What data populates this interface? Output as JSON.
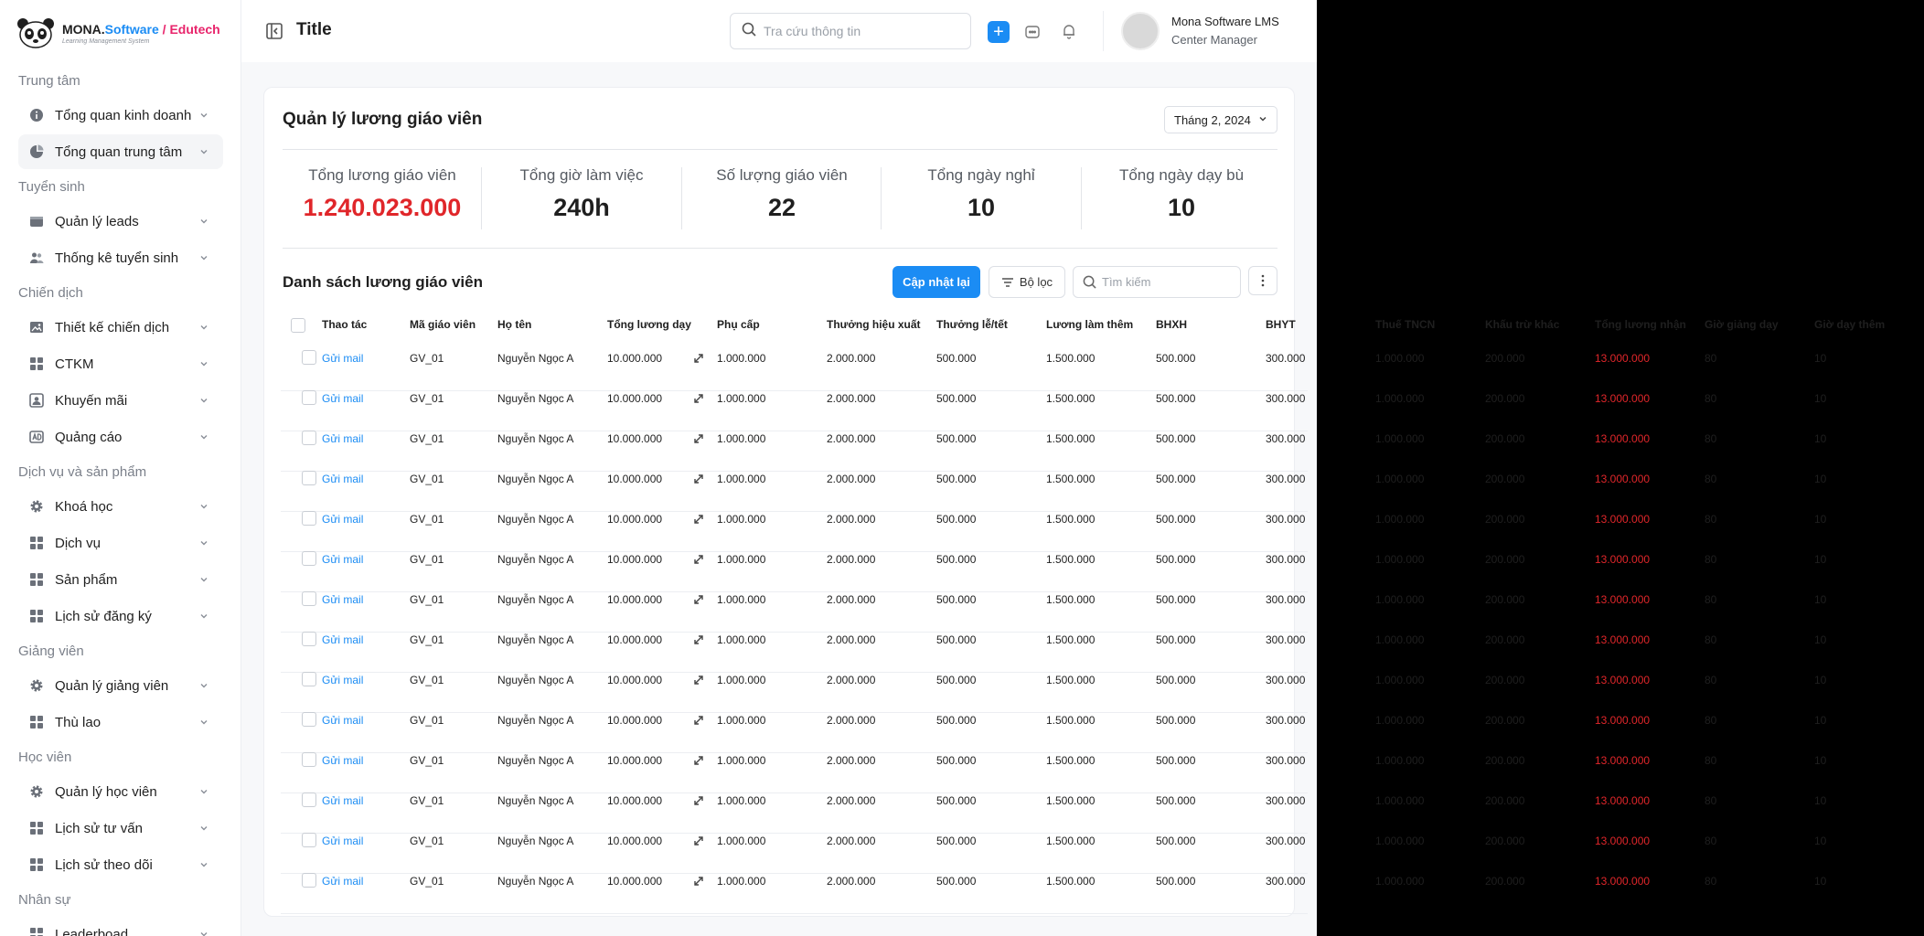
{
  "brand": {
    "name_part1": "MONA",
    "name_part2": "Software",
    "slash": " / ",
    "name_part3": "Edutech",
    "tagline": "Learning Management System"
  },
  "sidebar": {
    "groups": [
      {
        "label": "Trung tâm",
        "items": [
          {
            "label": "Tổng quan kinh doanh",
            "icon": "info-icon"
          },
          {
            "label": "Tổng quan trung tâm",
            "icon": "pie-chart-icon",
            "active": true
          }
        ]
      },
      {
        "label": "Tuyển sinh",
        "items": [
          {
            "label": "Quản lý leads",
            "icon": "wallet-icon"
          },
          {
            "label": "Thống kê tuyển sinh",
            "icon": "users-icon"
          }
        ]
      },
      {
        "label": "Chiến dịch",
        "items": [
          {
            "label": "Thiết kế chiến dịch",
            "icon": "image-icon"
          },
          {
            "label": "CTKM",
            "icon": "grid-icon"
          },
          {
            "label": "Khuyến mãi",
            "icon": "user-card-icon"
          },
          {
            "label": "Quảng cáo",
            "icon": "ad-icon"
          }
        ]
      },
      {
        "label": "Dịch vụ và sản phẩm",
        "items": [
          {
            "label": "Khoá học",
            "icon": "gear-icon"
          },
          {
            "label": "Dịch vụ",
            "icon": "grid-icon"
          },
          {
            "label": "Sản phẩm",
            "icon": "grid-icon"
          },
          {
            "label": "Lịch sử đăng ký",
            "icon": "grid-icon"
          }
        ]
      },
      {
        "label": "Giảng viên",
        "items": [
          {
            "label": "Quản lý giảng viên",
            "icon": "gear-icon"
          },
          {
            "label": "Thù lao",
            "icon": "grid-icon"
          }
        ]
      },
      {
        "label": "Học viên",
        "items": [
          {
            "label": "Quản lý học viên",
            "icon": "gear-icon"
          },
          {
            "label": "Lịch sử tư vấn",
            "icon": "grid-icon"
          },
          {
            "label": "Lịch sử theo dõi",
            "icon": "grid-icon"
          }
        ]
      },
      {
        "label": "Nhân sự",
        "items": [
          {
            "label": "Leaderboad",
            "icon": "grid-icon"
          }
        ]
      }
    ]
  },
  "topbar": {
    "title": "Title",
    "search_placeholder": "Tra cứu thông tin",
    "add_label": "+",
    "user_name": "Mona Software LMS",
    "user_role": "Center Manager"
  },
  "card": {
    "title": "Quản lý lương giáo viên",
    "month": "Tháng 2, 2024",
    "stats": [
      {
        "label": "Tổng lương giáo viên",
        "value": "1.240.023.000",
        "highlight": true
      },
      {
        "label": "Tổng giờ làm việc",
        "value": "240h"
      },
      {
        "label": "Số lượng giáo viên",
        "value": "22"
      },
      {
        "label": "Tổng ngày nghỉ",
        "value": "10"
      },
      {
        "label": "Tổng ngày dạy bù",
        "value": "10"
      }
    ],
    "list_title": "Danh sách lương giáo viên",
    "update_label": "Cập nhật lại",
    "filter_label": "Bộ lọc",
    "search_placeholder": "Tìm kiếm"
  },
  "table": {
    "columns": [
      "Thao tác",
      "Mã giáo viên",
      "Họ tên",
      "Tổng lương dạy",
      "Phụ cấp",
      "Thưởng hiệu xuất",
      "Thưởng lễ/tết",
      "Lương làm thêm",
      "BHXH",
      "BHYT",
      "Thuế TNCN",
      "Khấu trừ khác",
      "Tổng lương nhận",
      "Giờ giảng dạy",
      "Giờ dạy thêm"
    ],
    "rows": [
      [
        "Gửi mail",
        "GV_01",
        "Nguyễn Ngọc A",
        "10.000.000",
        "1.000.000",
        "2.000.000",
        "500.000",
        "1.500.000",
        "500.000",
        "300.000",
        "1.000.000",
        "200.000",
        "13.000.000",
        "80",
        "10"
      ],
      [
        "Gửi mail",
        "GV_01",
        "Nguyễn Ngọc A",
        "10.000.000",
        "1.000.000",
        "2.000.000",
        "500.000",
        "1.500.000",
        "500.000",
        "300.000",
        "1.000.000",
        "200.000",
        "13.000.000",
        "80",
        "10"
      ],
      [
        "Gửi mail",
        "GV_01",
        "Nguyễn Ngọc A",
        "10.000.000",
        "1.000.000",
        "2.000.000",
        "500.000",
        "1.500.000",
        "500.000",
        "300.000",
        "1.000.000",
        "200.000",
        "13.000.000",
        "80",
        "10"
      ],
      [
        "Gửi mail",
        "GV_01",
        "Nguyễn Ngọc A",
        "10.000.000",
        "1.000.000",
        "2.000.000",
        "500.000",
        "1.500.000",
        "500.000",
        "300.000",
        "1.000.000",
        "200.000",
        "13.000.000",
        "80",
        "10"
      ],
      [
        "Gửi mail",
        "GV_01",
        "Nguyễn Ngọc A",
        "10.000.000",
        "1.000.000",
        "2.000.000",
        "500.000",
        "1.500.000",
        "500.000",
        "300.000",
        "1.000.000",
        "200.000",
        "13.000.000",
        "80",
        "10"
      ],
      [
        "Gửi mail",
        "GV_01",
        "Nguyễn Ngọc A",
        "10.000.000",
        "1.000.000",
        "2.000.000",
        "500.000",
        "1.500.000",
        "500.000",
        "300.000",
        "1.000.000",
        "200.000",
        "13.000.000",
        "80",
        "10"
      ],
      [
        "Gửi mail",
        "GV_01",
        "Nguyễn Ngọc A",
        "10.000.000",
        "1.000.000",
        "2.000.000",
        "500.000",
        "1.500.000",
        "500.000",
        "300.000",
        "1.000.000",
        "200.000",
        "13.000.000",
        "80",
        "10"
      ],
      [
        "Gửi mail",
        "GV_01",
        "Nguyễn Ngọc A",
        "10.000.000",
        "1.000.000",
        "2.000.000",
        "500.000",
        "1.500.000",
        "500.000",
        "300.000",
        "1.000.000",
        "200.000",
        "13.000.000",
        "80",
        "10"
      ],
      [
        "Gửi mail",
        "GV_01",
        "Nguyễn Ngọc A",
        "10.000.000",
        "1.000.000",
        "2.000.000",
        "500.000",
        "1.500.000",
        "500.000",
        "300.000",
        "1.000.000",
        "200.000",
        "13.000.000",
        "80",
        "10"
      ],
      [
        "Gửi mail",
        "GV_01",
        "Nguyễn Ngọc A",
        "10.000.000",
        "1.000.000",
        "2.000.000",
        "500.000",
        "1.500.000",
        "500.000",
        "300.000",
        "1.000.000",
        "200.000",
        "13.000.000",
        "80",
        "10"
      ],
      [
        "Gửi mail",
        "GV_01",
        "Nguyễn Ngọc A",
        "10.000.000",
        "1.000.000",
        "2.000.000",
        "500.000",
        "1.500.000",
        "500.000",
        "300.000",
        "1.000.000",
        "200.000",
        "13.000.000",
        "80",
        "10"
      ],
      [
        "Gửi mail",
        "GV_01",
        "Nguyễn Ngọc A",
        "10.000.000",
        "1.000.000",
        "2.000.000",
        "500.000",
        "1.500.000",
        "500.000",
        "300.000",
        "1.000.000",
        "200.000",
        "13.000.000",
        "80",
        "10"
      ],
      [
        "Gửi mail",
        "GV_01",
        "Nguyễn Ngọc A",
        "10.000.000",
        "1.000.000",
        "2.000.000",
        "500.000",
        "1.500.000",
        "500.000",
        "300.000",
        "1.000.000",
        "200.000",
        "13.000.000",
        "80",
        "10"
      ],
      [
        "Gửi mail",
        "GV_01",
        "Nguyễn Ngọc A",
        "10.000.000",
        "1.000.000",
        "2.000.000",
        "500.000",
        "1.500.000",
        "500.000",
        "300.000",
        "1.000.000",
        "200.000",
        "13.000.000",
        "80",
        "10"
      ]
    ]
  },
  "colors": {
    "accent": "#1b8cf4",
    "highlight_red": "#e0262a",
    "brand_pink": "#e8246b"
  }
}
